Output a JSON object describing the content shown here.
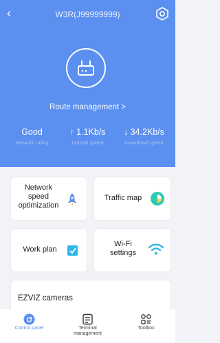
{
  "header": {
    "back_icon": "chevron-left-icon",
    "title": "W3R(J99999999)",
    "settings_icon": "hexagon-settings-icon",
    "router_icon": "router-icon",
    "route_link": "Route management >"
  },
  "stats": [
    {
      "value": "Good",
      "label": "Network rating"
    },
    {
      "value": "↑ 1.1Kb/s",
      "label": "Upload speed"
    },
    {
      "value": "↓ 34.2Kb/s",
      "label": "Download speed"
    }
  ],
  "cards": {
    "speed_opt": {
      "label_line1": "Network",
      "label_line2": "speed",
      "label_line3": "optimization",
      "icon": "rocket-icon"
    },
    "traffic_map": {
      "label": "Traffic map",
      "icon": "pie-chart-icon"
    },
    "work_plan": {
      "label": "Work plan",
      "icon": "checkbox-icon"
    },
    "wifi": {
      "label_line1": "Wi-Fi",
      "label_line2": "settings",
      "icon": "wifi-icon"
    },
    "ezviz": {
      "label": "EZVIZ cameras"
    }
  },
  "tabs": [
    {
      "label": "Control panel",
      "icon": "control-panel-icon",
      "active": true
    },
    {
      "label_line1": "Terminal",
      "label_line2": "management",
      "icon": "terminal-icon"
    },
    {
      "label": "Toolbox",
      "icon": "toolbox-icon"
    }
  ],
  "colors": {
    "accent": "#5b8ff0",
    "teal": "#2ec9b2",
    "rocket": "#5b8ff0"
  }
}
